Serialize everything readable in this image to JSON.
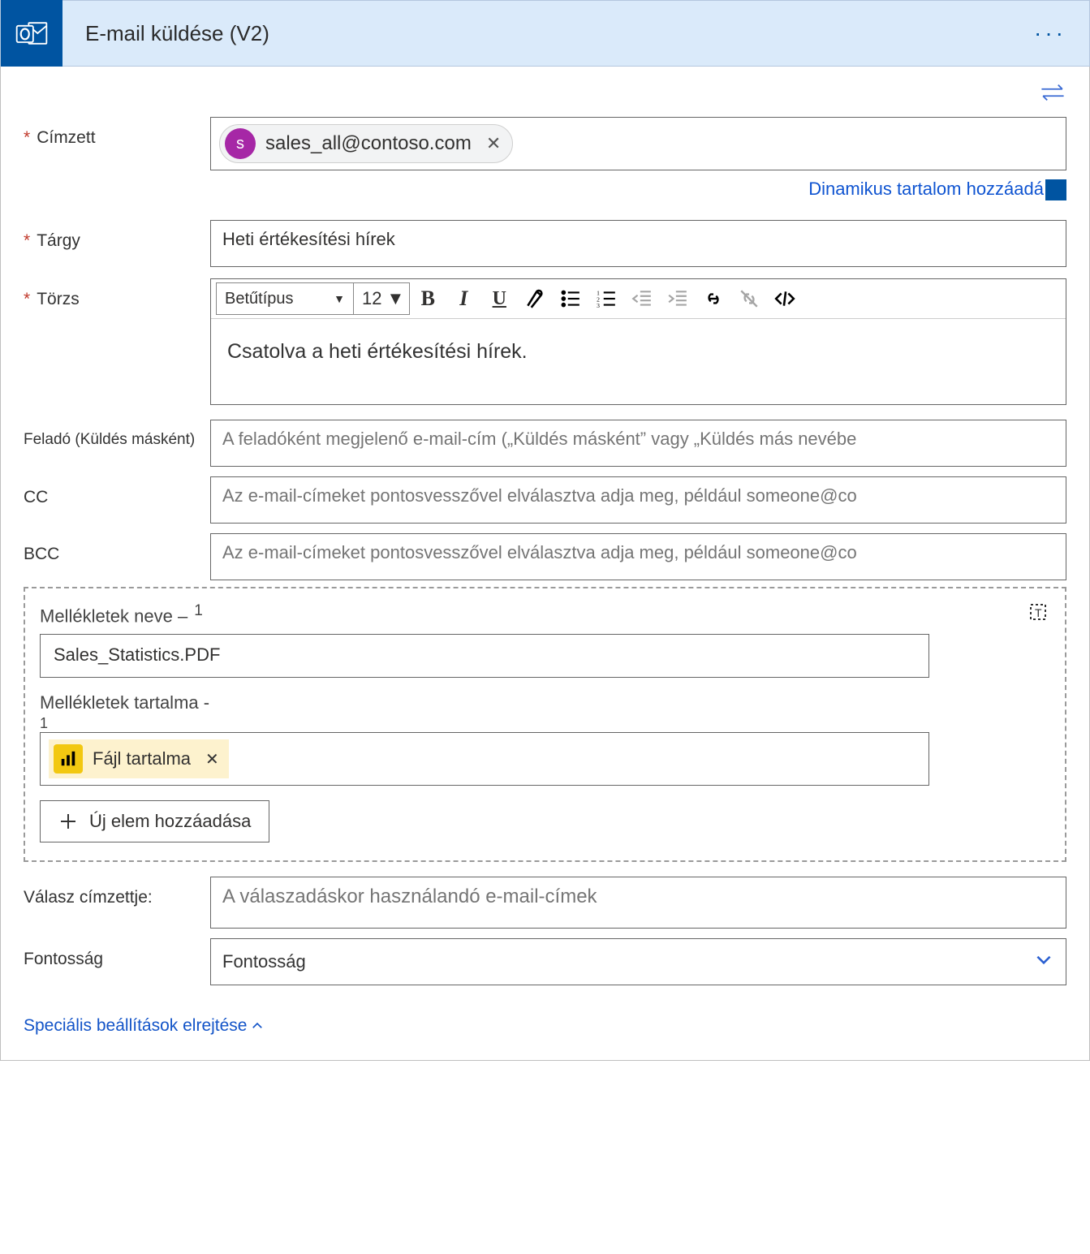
{
  "header": {
    "title": "E-mail küldése (V2)"
  },
  "labels": {
    "to": "Címzett",
    "subject": "Tárgy",
    "body": "Törzs",
    "from": "Feladó (Küldés másként)",
    "cc": "CC",
    "bcc": "BCC",
    "attachments_name": "Mellékletek neve –",
    "attachments_name_index": "1",
    "attachments_content": "Mellékletek tartalma  -",
    "attachments_content_index": "1",
    "reply_to": "Válasz címzettje:",
    "importance": "Fontosság"
  },
  "to": {
    "avatar_initial": "s",
    "address": "sales_all@contoso.com"
  },
  "dynamic_link": "Dinamikus tartalom hozzáadá",
  "subject_value": "Heti értékesítési hírek",
  "toolbar": {
    "font_label": "Betűtípus",
    "size_label": "12"
  },
  "body_text": "Csatolva a heti értékesítési hírek.",
  "placeholders": {
    "from": "A feladóként megjelenő e-mail-cím („Küldés másként” vagy „Küldés más nevébe",
    "cc": "Az e-mail-címeket pontosvesszővel elválasztva adja meg, például someone@co",
    "bcc": "Az e-mail-címeket pontosvesszővel elválasztva adja meg, például someone@co",
    "reply_to": "A válaszadáskor használandó e-mail-címek",
    "importance": "Fontosság"
  },
  "attachment": {
    "name_value": "Sales_Statistics.PDF",
    "content_token_label": "Fájl tartalma"
  },
  "add_item_label": "Új elem hozzáadása",
  "hide_advanced_label": "Speciális beállítások elrejtése"
}
